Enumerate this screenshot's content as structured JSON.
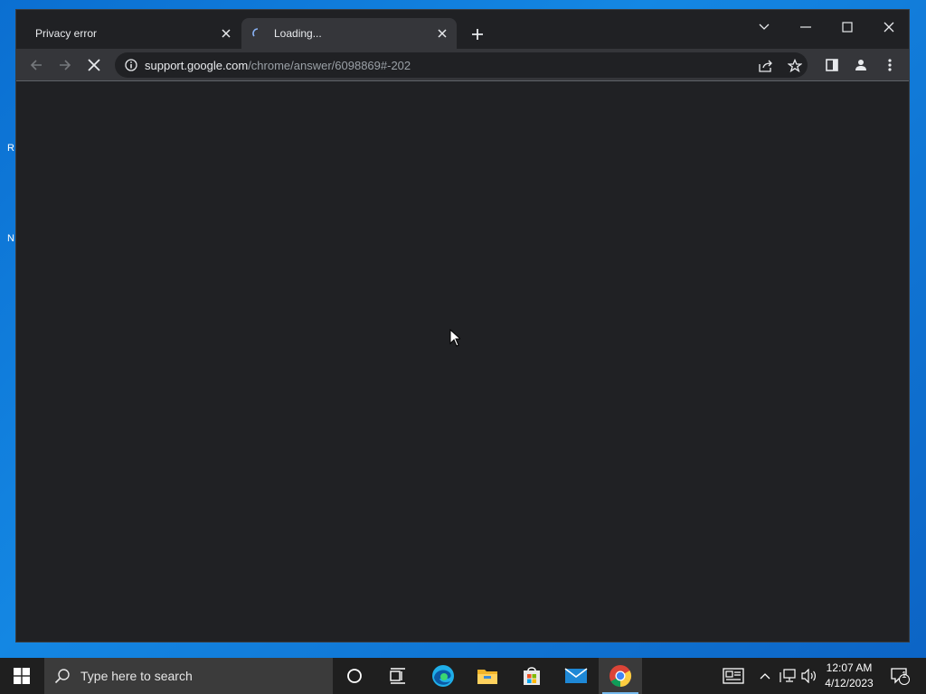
{
  "browser": {
    "tabs": [
      {
        "title": "Privacy error",
        "active": false
      },
      {
        "title": "Loading...",
        "active": true
      }
    ],
    "address_bar": {
      "host": "support.google.com",
      "path": "/chrome/answer/6098869#-202"
    }
  },
  "taskbar": {
    "search_placeholder": "Type here to search",
    "clock": {
      "time": "12:07 AM",
      "date": "4/12/2023"
    },
    "notification_count": "1"
  },
  "desktop": {
    "peek_labels": [
      "R",
      "N"
    ]
  },
  "colors": {
    "accent": "#76b9ed",
    "desktop": "#1487e3",
    "window": "#202124",
    "toolbar": "#35363a"
  }
}
